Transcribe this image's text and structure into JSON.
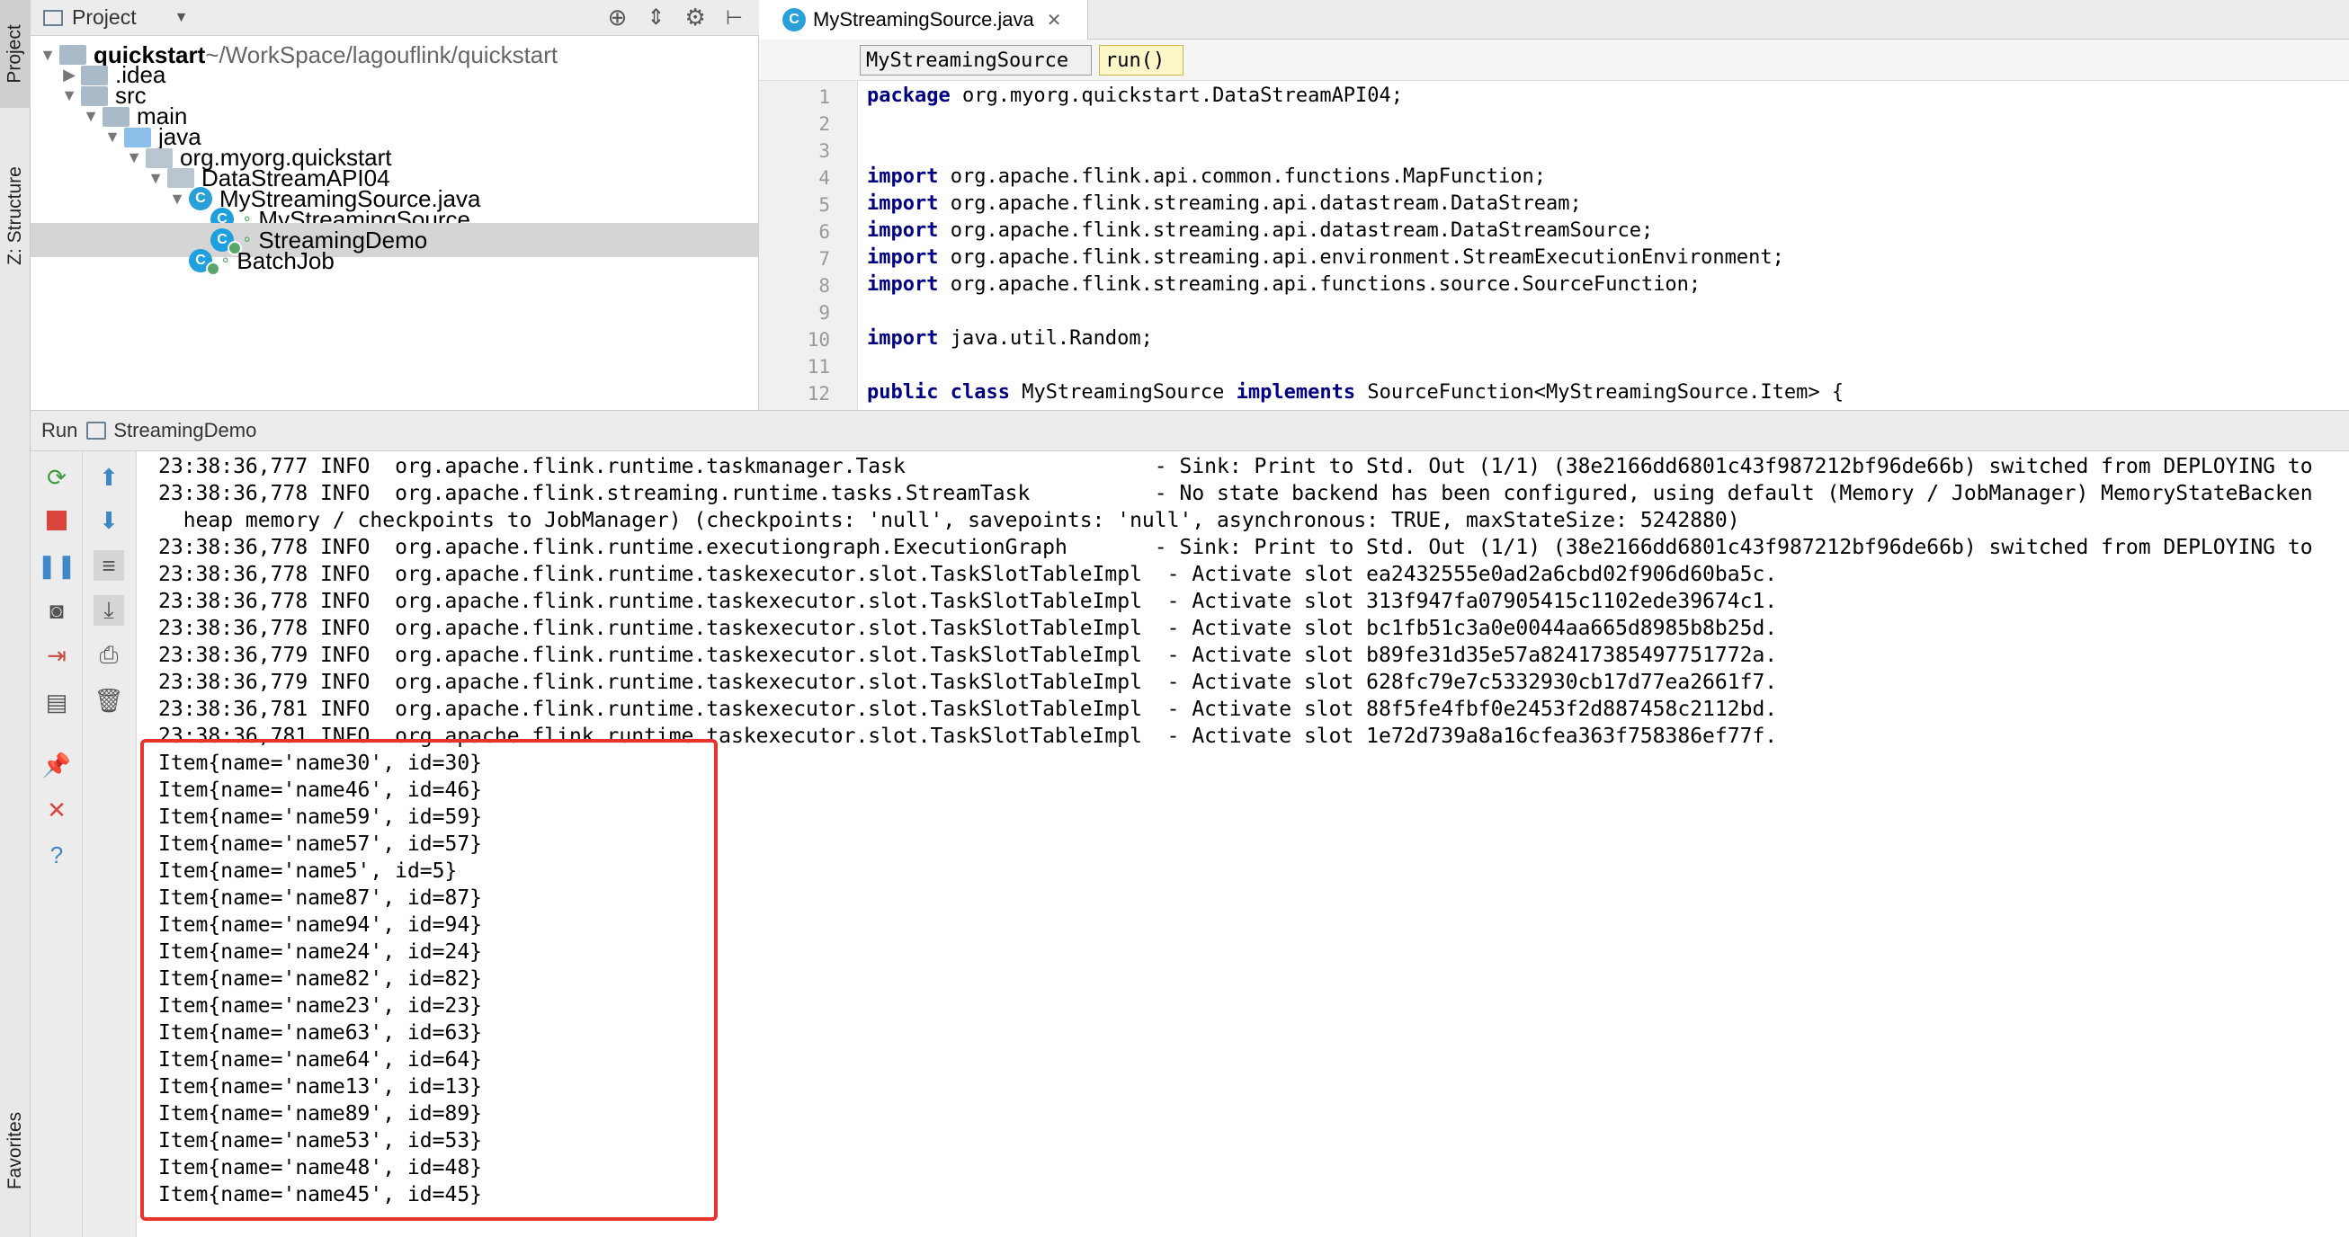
{
  "left_strip": {
    "project_tab": "Project",
    "structure_tab": "Z: Structure",
    "favorites_tab": "Favorites"
  },
  "project_panel": {
    "title": "Project",
    "tree": [
      {
        "label": "quickstart",
        "suffix": " ~/WorkSpace/lagouflink/quickstart",
        "depth": 0,
        "kind": "folder",
        "expanded": true,
        "bold": true
      },
      {
        "label": ".idea",
        "depth": 1,
        "kind": "folder",
        "expanded": false
      },
      {
        "label": "src",
        "depth": 1,
        "kind": "folder",
        "expanded": true
      },
      {
        "label": "main",
        "depth": 2,
        "kind": "folder",
        "expanded": true
      },
      {
        "label": "java",
        "depth": 3,
        "kind": "folder-blue",
        "expanded": true
      },
      {
        "label": "org.myorg.quickstart",
        "depth": 4,
        "kind": "package",
        "expanded": true
      },
      {
        "label": "DataStreamAPI04",
        "depth": 5,
        "kind": "package",
        "expanded": true
      },
      {
        "label": "MyStreamingSource.java",
        "depth": 6,
        "kind": "java-file",
        "expanded": true
      },
      {
        "label": "MyStreamingSource",
        "depth": 7,
        "kind": "class"
      },
      {
        "label": "StreamingDemo",
        "depth": 7,
        "kind": "class-run",
        "selected": true
      },
      {
        "label": "BatchJob",
        "depth": 6,
        "kind": "class-run"
      }
    ]
  },
  "editor": {
    "tab_label": "MyStreamingSource.java",
    "breadcrumb": [
      "MyStreamingSource",
      "run()"
    ],
    "line_numbers": [
      "1",
      "2",
      "3",
      "4",
      "5",
      "6",
      "7",
      "8",
      "9",
      "10",
      "11",
      "12"
    ],
    "lines": [
      {
        "kw": "package",
        "text": " org.myorg.quickstart.DataStreamAPI04;"
      },
      {
        "kw": "",
        "text": ""
      },
      {
        "kw": "",
        "text": ""
      },
      {
        "kw": "import",
        "text": " org.apache.flink.api.common.functions.MapFunction;"
      },
      {
        "kw": "import",
        "text": " org.apache.flink.streaming.api.datastream.DataStream;"
      },
      {
        "kw": "import",
        "text": " org.apache.flink.streaming.api.datastream.DataStreamSource;"
      },
      {
        "kw": "import",
        "text": " org.apache.flink.streaming.api.environment.StreamExecutionEnvironment;"
      },
      {
        "kw": "import",
        "text": " org.apache.flink.streaming.api.functions.source.SourceFunction;"
      },
      {
        "kw": "",
        "text": ""
      },
      {
        "kw": "import",
        "text": " java.util.Random;"
      },
      {
        "kw": "",
        "text": ""
      },
      {
        "kw": "public class",
        "text": " MyStreamingSource implements SourceFunction<MyStreamingSource.Item> {"
      }
    ]
  },
  "run_panel": {
    "label": "Run",
    "config": "StreamingDemo",
    "log_lines": [
      "23:38:36,777 INFO  org.apache.flink.runtime.taskmanager.Task                    - Sink: Print to Std. Out (1/1) (38e2166dd6801c43f987212bf96de66b) switched from DEPLOYING to",
      "23:38:36,778 INFO  org.apache.flink.streaming.runtime.tasks.StreamTask          - No state backend has been configured, using default (Memory / JobManager) MemoryStateBacken",
      "  heap memory / checkpoints to JobManager) (checkpoints: 'null', savepoints: 'null', asynchronous: TRUE, maxStateSize: 5242880)",
      "23:38:36,778 INFO  org.apache.flink.runtime.executiongraph.ExecutionGraph       - Sink: Print to Std. Out (1/1) (38e2166dd6801c43f987212bf96de66b) switched from DEPLOYING to",
      "23:38:36,778 INFO  org.apache.flink.runtime.taskexecutor.slot.TaskSlotTableImpl  - Activate slot ea2432555e0ad2a6cbd02f906d60ba5c.",
      "23:38:36,778 INFO  org.apache.flink.runtime.taskexecutor.slot.TaskSlotTableImpl  - Activate slot 313f947fa07905415c1102ede39674c1.",
      "23:38:36,778 INFO  org.apache.flink.runtime.taskexecutor.slot.TaskSlotTableImpl  - Activate slot bc1fb51c3a0e0044aa665d8985b8b25d.",
      "23:38:36,779 INFO  org.apache.flink.runtime.taskexecutor.slot.TaskSlotTableImpl  - Activate slot b89fe31d35e57a82417385497751772a.",
      "23:38:36,779 INFO  org.apache.flink.runtime.taskexecutor.slot.TaskSlotTableImpl  - Activate slot 628fc79e7c5332930cb17d77ea2661f7.",
      "23:38:36,781 INFO  org.apache.flink.runtime.taskexecutor.slot.TaskSlotTableImpl  - Activate slot 88f5fe4fbf0e2453f2d887458c2112bd.",
      "23:38:36,781 INFO  org.apache.flink.runtime.taskexecutor.slot.TaskSlotTableImpl  - Activate slot 1e72d739a8a16cfea363f758386ef77f.",
      "Item{name='name30', id=30}",
      "Item{name='name46', id=46}",
      "Item{name='name59', id=59}",
      "Item{name='name57', id=57}",
      "Item{name='name5', id=5}",
      "Item{name='name87', id=87}",
      "Item{name='name94', id=94}",
      "Item{name='name24', id=24}",
      "Item{name='name82', id=82}",
      "Item{name='name23', id=23}",
      "Item{name='name63', id=63}",
      "Item{name='name64', id=64}",
      "Item{name='name13', id=13}",
      "Item{name='name89', id=89}",
      "Item{name='name53', id=53}",
      "Item{name='name48', id=48}",
      "Item{name='name45', id=45}"
    ]
  },
  "colors": {
    "highlight": "#e8342c",
    "keyword": "#000080",
    "selection": "#d5d5d5",
    "accent_green": "#59a869",
    "accent_blue": "#2aa0d8"
  }
}
